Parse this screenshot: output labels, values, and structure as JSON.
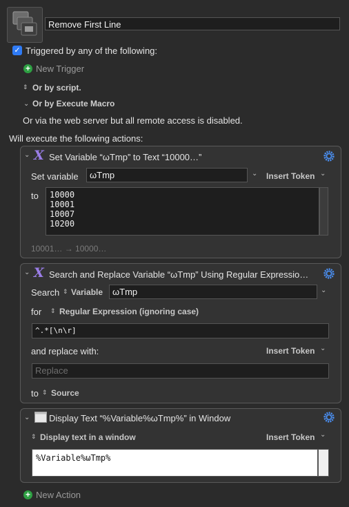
{
  "macro": {
    "name": "Remove First Line",
    "triggered_label": "Triggered by any of the following:",
    "new_trigger": "New Trigger",
    "or_by_script": "Or by script.",
    "or_by_execute_macro": "Or by Execute Macro",
    "web_server_note": "Or via the web server but all remote access is disabled.",
    "will_execute": "Will execute the following actions:",
    "new_action": "New Action"
  },
  "actions": [
    {
      "title": "Set Variable “ωTmp” to Text “10000…”",
      "set_variable_label": "Set variable",
      "variable": "ωTmp",
      "insert_token": "Insert Token",
      "to_label": "to",
      "text_lines": [
        "10000",
        "10001",
        "10007",
        "10200"
      ],
      "preview": "10001… → 10000…"
    },
    {
      "title": "Search and Replace Variable “ωTmp” Using Regular Expressio…",
      "search_label": "Search",
      "source_type": "Variable",
      "variable": "ωTmp",
      "for_label": "for",
      "match_type": "Regular Expression (ignoring case)",
      "pattern": "^.*[\\n\\r]",
      "replace_label": "and replace with:",
      "insert_token": "Insert Token",
      "replace_placeholder": "Replace",
      "to_label": "to",
      "destination": "Source"
    },
    {
      "title": "Display Text “%Variable%ωTmp%” in Window",
      "display_mode": "Display text in a window",
      "insert_token": "Insert Token",
      "text": "%Variable%ωTmp%"
    }
  ],
  "colors": {
    "accent_blue": "#2f7bf5",
    "add_green": "#2ea043",
    "x_icon_purple": "#9b7ee8",
    "gear_blue": "#4a8ef0"
  }
}
